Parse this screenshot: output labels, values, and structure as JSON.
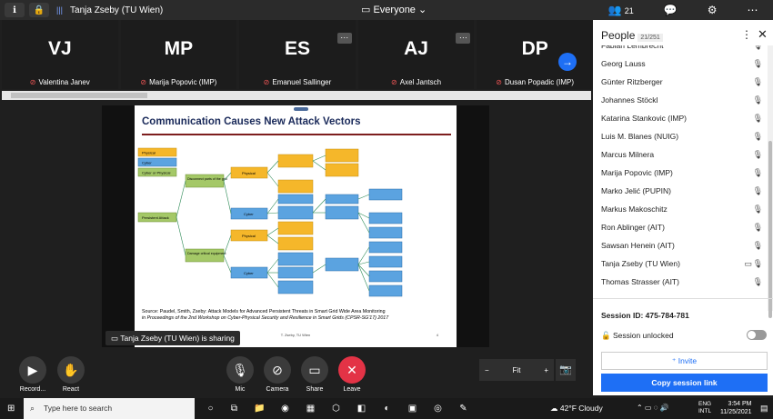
{
  "topbar": {
    "meeting_name": "Tanja Zseby (TU Wien)",
    "audience": "Everyone",
    "participants_count": "21"
  },
  "tiles": [
    {
      "initials": "VJ",
      "name": "Valentina Janev"
    },
    {
      "initials": "MP",
      "name": "Marija Popovic (IMP)"
    },
    {
      "initials": "ES",
      "name": "Emanuel Sallinger"
    },
    {
      "initials": "AJ",
      "name": "Axel Jantsch"
    },
    {
      "initials": "DP",
      "name": "Dusan Popadic (IMP)"
    }
  ],
  "slide": {
    "title": "Communication Causes New Attack Vectors",
    "source_line1": "Source: Paudel, Smith, Zseby: Attack Models for Advanced Persistent Threats in Smart Grid Wide Area Monitoring",
    "source_line2": "in Proceedings of the 2nd Workshop on Cyber-Physical Security and Resilience in Smart Grids (CPSR-SG'17) 2017",
    "footer": "T. Zseby, TU Wien",
    "page": "4",
    "legend": [
      "Physical",
      "Cyber",
      "Cyber or Physical"
    ],
    "nodes_left": [
      "Persistent Attack",
      "Disconnect parts of the grid",
      "Damage critical equipment"
    ],
    "nodes_mid": [
      "Physical",
      "Cyber",
      "Physical",
      "Cyber"
    ]
  },
  "sharing_label": "Tanja Zseby (TU Wien) is sharing",
  "controls": {
    "record": "Record...",
    "react": "React",
    "mic": "Mic",
    "camera": "Camera",
    "share": "Share",
    "leave": "Leave",
    "zoom": "Fit"
  },
  "panel": {
    "title": "People",
    "count": "21/251",
    "people": [
      "Fabian Lembrecht",
      "Georg Lauss",
      "Günter Ritzberger",
      "Johannes Stöckl",
      "Katarina Stankovic (IMP)",
      "Luis M. Blanes (NUIG)",
      "Marcus Milnera",
      "Marija Popovic (IMP)",
      "Marko Jelić (PUPIN)",
      "Markus Makoschitz",
      "Ron Ablinger (AIT)",
      "Sawsan Henein (AIT)",
      "Tanja Zseby (TU Wien)",
      "Thomas Strasser (AIT)"
    ],
    "session_id": "Session ID: 475-784-781",
    "session_unlocked": "Session unlocked",
    "invite": "Invite",
    "copy_link": "Copy session link"
  },
  "taskbar": {
    "search_placeholder": "Type here to search",
    "weather": "42°F  Cloudy",
    "lang_top": "ENG",
    "lang_bottom": "INTL",
    "time": "3:54 PM",
    "date": "11/25/2021"
  }
}
